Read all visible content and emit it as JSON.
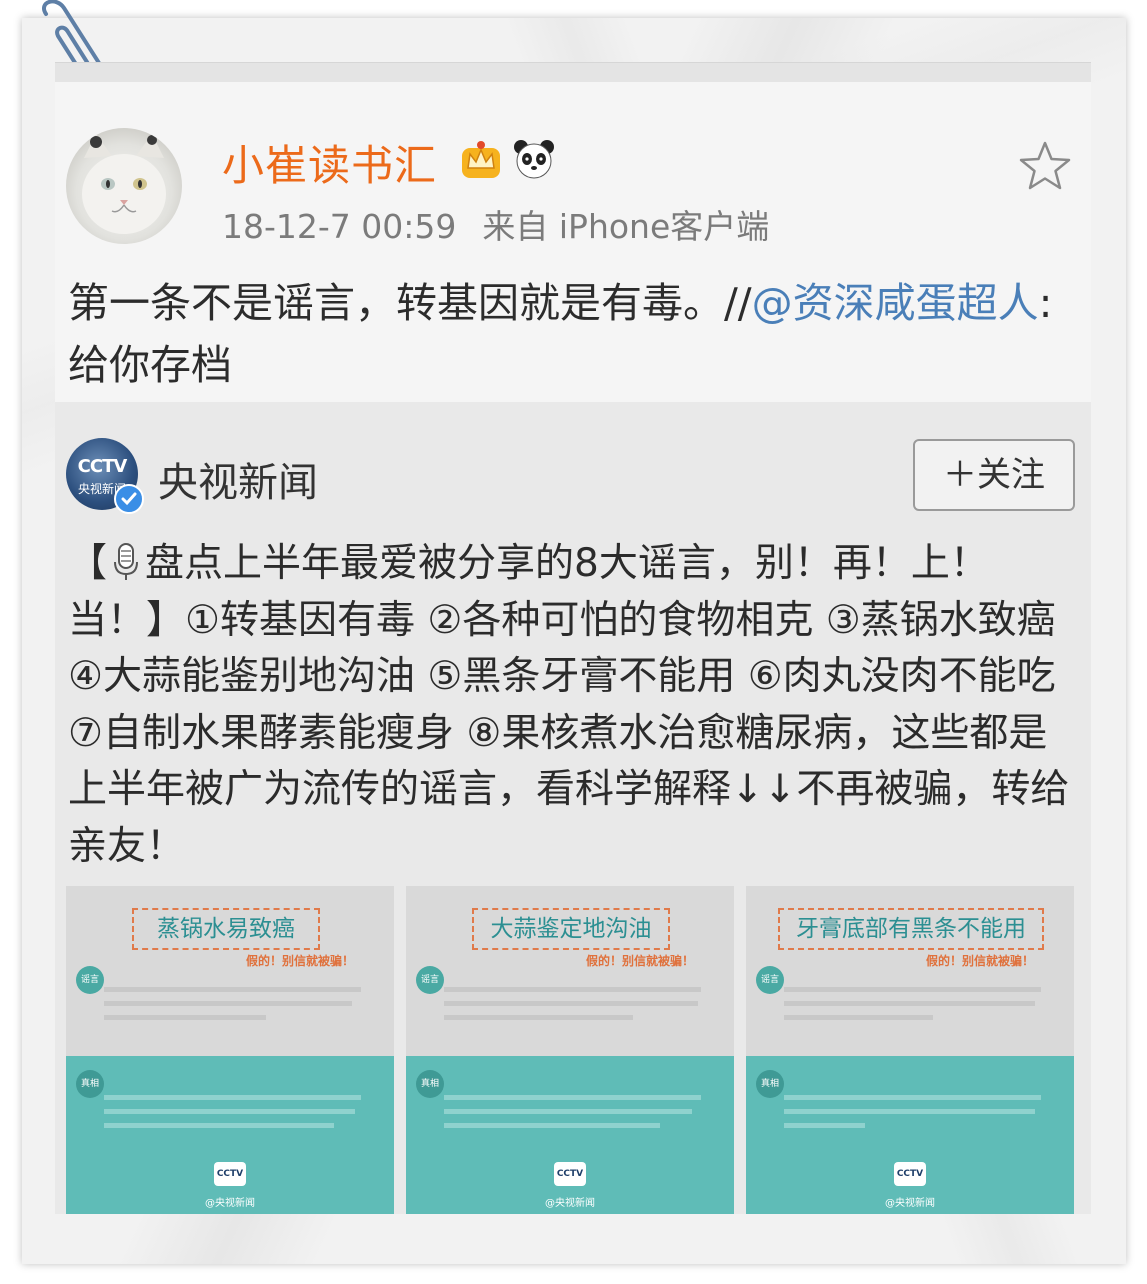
{
  "post": {
    "username": "小崔读书汇",
    "timestamp": "18-12-7 00:59",
    "source": "来自 iPhone客户端",
    "text_before": "第一条不是谣言，转基因就是有毒。//",
    "mention": "@资深咸蛋超人",
    "text_after": ":给你存档"
  },
  "repost": {
    "account": {
      "name": "央视新闻",
      "avatar_text": "CCTV",
      "avatar_sub": "央视新闻"
    },
    "follow_label": "＋关注",
    "text_open": "【",
    "text_body": "盘点上半年最爱被分享的8大谣言，别！再！上！当！】①转基因有毒 ②各种可怕的食物相克 ③蒸锅水致癌 ④大蒜能鉴别地沟油 ⑤黑条牙膏不能用 ⑥肉丸没肉不能吃 ⑦自制水果酵素能瘦身 ⑧果核煮水治愈糖尿病，这些都是上半年被广为流传的谣言，看科学解释↓↓不再被骗，转给亲友！"
  },
  "thumbnails": [
    {
      "title": "蒸锅水易致癌",
      "subtitle": "假的！别信就被骗！",
      "tag_rumor": "谣言",
      "tag_truth": "真相",
      "logo": "CCTV",
      "credit": "@央视新闻"
    },
    {
      "title": "大蒜鉴定地沟油",
      "subtitle": "假的！别信就被骗！",
      "tag_rumor": "谣言",
      "tag_truth": "真相",
      "logo": "CCTV",
      "credit": "@央视新闻"
    },
    {
      "title": "牙膏底部有黑条不能用",
      "subtitle": "假的！别信就被骗！",
      "tag_rumor": "谣言",
      "tag_truth": "真相",
      "logo": "CCTV",
      "credit": "@央视新闻"
    }
  ],
  "icons": {
    "badge1": "crown-badge-icon",
    "badge2": "panda-icon",
    "favorite": "star-icon",
    "mic": "microphone-icon",
    "verified": "verified-icon",
    "clip": "paperclip-icon"
  },
  "colors": {
    "username": "#ec6a1a",
    "mention": "#4a7fb8",
    "thumb_teal": "#5fbcb7"
  }
}
